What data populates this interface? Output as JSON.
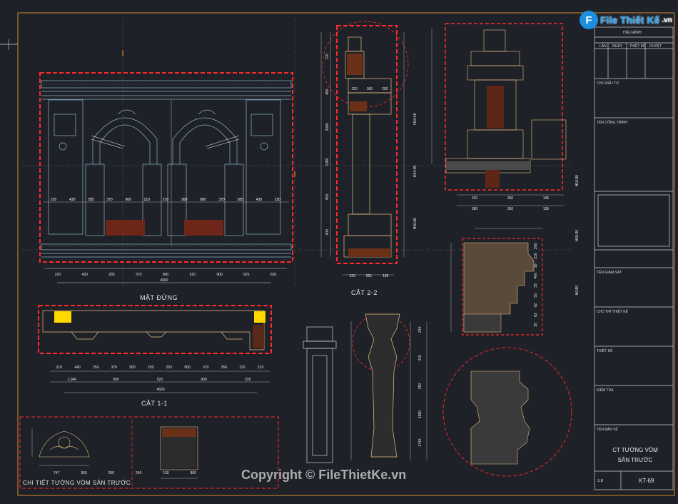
{
  "logo": {
    "badge": "F",
    "text": "File Thiết Kế",
    "suffix": ".vn"
  },
  "watermark": "Copyright © FileThietKe.vn",
  "labels": {
    "mat_dung": "MẶT ĐỨNG",
    "cat_2_2": "CẮT 2-2",
    "cat_1_1": "CẮT 1-1",
    "chi_tiet": "CHI TIẾT TƯỜNG VÒM SÂN TRƯỚC"
  },
  "title_block": {
    "revision": "HIỆU ĐÍNH",
    "col_headers": [
      "LẦN",
      "NGÀY",
      "THIẾT KẾ",
      "DUYỆT"
    ],
    "owner": "CHỦ ĐẦU TƯ",
    "project": "TÊN CÔNG TRÌNH",
    "supervisor": "TÊN GIÁM SÁT",
    "designer_lead": "CHỦ TRÌ THIẾT KẾ",
    "designer": "THIẾT KẾ",
    "checker": "KIỂM TRA",
    "drawing_name": "TÊN BẢN VẼ",
    "drawing_title_1": "CT TƯỜNG VÒM",
    "drawing_title_2": "SÂN TRƯỚC",
    "sheet_label": "S.B",
    "sheet_number": "KT-69"
  },
  "dims": {
    "elev_bottom": [
      "220",
      "430",
      "285",
      "370",
      "900",
      "520",
      "900",
      "625",
      "650"
    ],
    "elev_total": "4600",
    "elev_inner": [
      "220",
      "430",
      "285",
      "370",
      "900",
      "210",
      "210",
      "260",
      "900",
      "370",
      "285",
      "430",
      "220"
    ],
    "sec11_row1": [
      "210",
      "440",
      "250",
      "370",
      "900",
      "250",
      "253",
      "900",
      "370",
      "250",
      "220",
      "210"
    ],
    "sec11_row2": [
      "1,046",
      "900",
      "520",
      "900",
      "535"
    ],
    "sec11_total": "4600",
    "sec22_bottom": [
      "220",
      "501",
      "195"
    ],
    "sec22_top": [
      "220",
      "360",
      "250"
    ],
    "col_right_bottom": [
      "220",
      "300",
      "195"
    ],
    "col_right_mid": [
      "280",
      "350",
      "195"
    ],
    "elev_marks": [
      "H14.40",
      "H14.45",
      "H10.60"
    ],
    "right_marks": [
      "H10.80",
      "H10.60",
      "H0.80"
    ],
    "sec22_vertical": [
      "720",
      "450",
      "3000",
      "1380",
      "450",
      "400"
    ],
    "detail_dims": [
      "305",
      "210",
      "10",
      "400",
      "35",
      "50",
      "62",
      "63",
      "35"
    ],
    "baluster": [
      "240",
      "410",
      "250",
      "1880",
      "1740"
    ],
    "bottom_detail": [
      "747",
      "350",
      "260",
      "240",
      "130",
      "800"
    ]
  }
}
